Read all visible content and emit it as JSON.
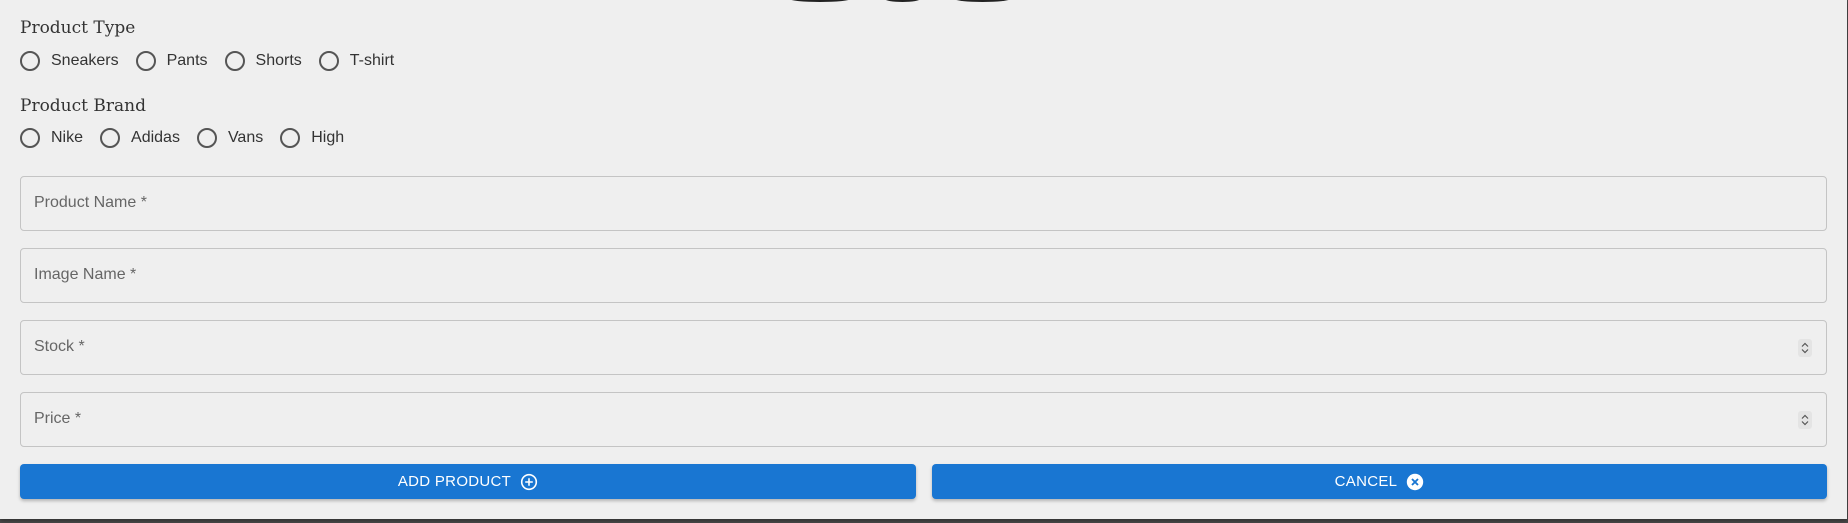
{
  "product_type": {
    "label": "Product Type",
    "options": [
      "Sneakers",
      "Pants",
      "Shorts",
      "T-shirt"
    ]
  },
  "product_brand": {
    "label": "Product Brand",
    "options": [
      "Nike",
      "Adidas",
      "Vans",
      "High"
    ]
  },
  "fields": {
    "product_name": "Product Name *",
    "image_name": "Image Name *",
    "stock": "Stock *",
    "price": "Price *"
  },
  "buttons": {
    "add_label": "ADD PRODUCT",
    "add_icon": "add-circle-icon",
    "cancel_label": "CANCEL",
    "cancel_icon": "cancel-circle-icon"
  },
  "colors": {
    "primary": "#1976d2",
    "background": "#efefef"
  }
}
